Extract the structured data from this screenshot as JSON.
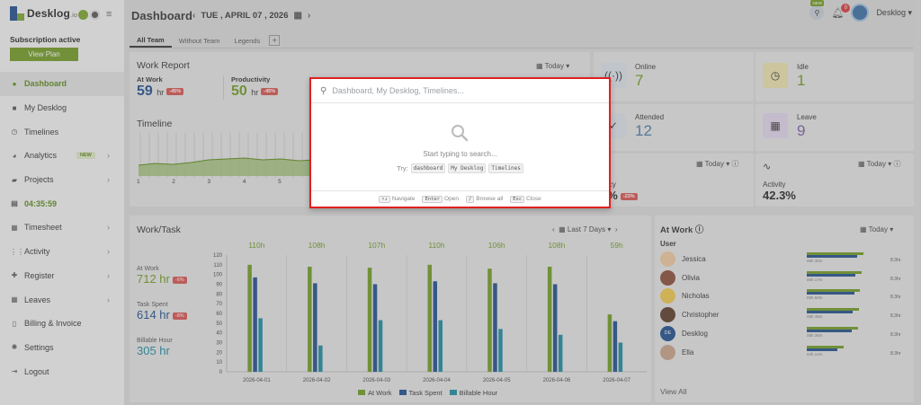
{
  "brand": {
    "name": "Desklog",
    "suffix": ".io"
  },
  "sidebar": {
    "subscription": "Subscription active",
    "view_plan": "View Plan",
    "items": [
      {
        "label": "Dashboard",
        "icon": "palette-icon"
      },
      {
        "label": "My Desklog",
        "icon": "briefcase-icon"
      },
      {
        "label": "Timelines",
        "icon": "clock-icon"
      },
      {
        "label": "Analytics",
        "icon": "pie-chart-icon",
        "badge": "NEW",
        "chevron": true
      },
      {
        "label": "Projects",
        "icon": "folder-icon",
        "chevron": true
      },
      {
        "label": "04:35:59",
        "icon": "timer-icon"
      },
      {
        "label": "Timesheet",
        "icon": "calendar-icon",
        "chevron": true
      },
      {
        "label": "Activity",
        "icon": "grid-icon",
        "chevron": true
      },
      {
        "label": "Register",
        "icon": "plus-icon",
        "chevron": true
      },
      {
        "label": "Leaves",
        "icon": "leaves-icon",
        "chevron": true
      },
      {
        "label": "Billing & Invoice",
        "icon": "invoice-icon"
      },
      {
        "label": "Settings",
        "icon": "gear-icon"
      },
      {
        "label": "Logout",
        "icon": "logout-icon"
      }
    ]
  },
  "header": {
    "title": "Dashboard",
    "date": "TUE , APRIL 07 , 2026",
    "notification_count": "0",
    "new_badge": "NEW",
    "user": "Desklog"
  },
  "tabs": [
    "All Team",
    "Without Team",
    "Legends"
  ],
  "work_report": {
    "title": "Work Report",
    "range": "Today",
    "at_work": {
      "label": "At Work",
      "value": "59",
      "unit": "hr",
      "delta": "-45%"
    },
    "productivity": {
      "label": "Productivity",
      "value": "50",
      "unit": "hr",
      "delta": "-45%"
    },
    "timeline_title": "Timeline",
    "timeline_ticks": [
      "1",
      "2",
      "3",
      "4",
      "5",
      "6"
    ]
  },
  "stats": {
    "online": {
      "label": "Online",
      "value": "7"
    },
    "idle": {
      "label": "Idle",
      "value": "1"
    },
    "attended": {
      "label": "Attended",
      "value": "12"
    },
    "leave": {
      "label": "Leave",
      "value": "9"
    },
    "efficiency": {
      "label": "ency",
      "value": "5%",
      "delta": "-23%",
      "range": "Today"
    },
    "activity": {
      "label": "Activity",
      "value": "42.3%",
      "range": "Today"
    }
  },
  "search_modal": {
    "placeholder": "Dashboard, My Desklog, Timelines...",
    "empty_text": "Start typing to search...",
    "try_label": "Try:",
    "suggestions": [
      "dashboard",
      "My Desklog",
      "Timelines"
    ],
    "footer": [
      {
        "key": "↑↓",
        "label": "Navigate"
      },
      {
        "key": "Enter",
        "label": "Open"
      },
      {
        "key": "/",
        "label": "Browse all"
      },
      {
        "key": "Esc",
        "label": "Close"
      }
    ]
  },
  "work_task": {
    "title": "Work/Task",
    "range": "Last 7 Days",
    "at_work": {
      "label": "At Work",
      "value": "712 hr",
      "delta": "-6%"
    },
    "task_spent": {
      "label": "Task Spent",
      "value": "614 hr",
      "delta": "-8%"
    },
    "billable": {
      "label": "Billable Hour",
      "value": "305 hr"
    }
  },
  "at_work_panel": {
    "title": "At Work",
    "range": "Today",
    "column": "User",
    "view_all": "View All",
    "users": [
      {
        "name": "Jessica",
        "time": "06h 30m",
        "total": "8.3hr",
        "color": "#f0c9a0",
        "work": 0.95,
        "task": 0.85
      },
      {
        "name": "Olivia",
        "time": "06h 17m",
        "total": "8.3hr",
        "color": "#8a4b38",
        "work": 0.93,
        "task": 0.82
      },
      {
        "name": "Nicholas",
        "time": "05h 50m",
        "total": "8.3hr",
        "color": "#f2c84b",
        "work": 0.9,
        "task": 0.8
      },
      {
        "name": "Christopher",
        "time": "05h 48m",
        "total": "8.3hr",
        "color": "#5b3a2a",
        "work": 0.88,
        "task": 0.78
      },
      {
        "name": "Desklog",
        "time": "05h 36m",
        "total": "8.3hr",
        "color": "#1d4d8c",
        "initials": "DE",
        "work": 0.86,
        "task": 0.75
      },
      {
        "name": "Ella",
        "time": "04h 14m",
        "total": "8.3hr",
        "color": "#c9a38a",
        "work": 0.62,
        "task": 0.52
      }
    ]
  },
  "chart_data": {
    "type": "bar",
    "categories": [
      "2026-04-01",
      "2026-04-02",
      "2026-04-03",
      "2026-04-04",
      "2026-04-05",
      "2026-04-06",
      "2026-04-07"
    ],
    "totals": [
      "110h",
      "108h",
      "107h",
      "110h",
      "106h",
      "108h",
      "59h"
    ],
    "series": [
      {
        "name": "At Work",
        "color": "#6f9a20",
        "values": [
          110,
          108,
          107,
          110,
          106,
          108,
          59
        ]
      },
      {
        "name": "Task Spent",
        "color": "#1d4d8c",
        "values": [
          97,
          91,
          90,
          93,
          91,
          90,
          52
        ]
      },
      {
        "name": "Billable Hour",
        "color": "#1b8aa0",
        "values": [
          55,
          27,
          53,
          53,
          44,
          38,
          30
        ]
      }
    ],
    "yticks": [
      0,
      10,
      20,
      30,
      40,
      50,
      60,
      70,
      80,
      90,
      100,
      110,
      120
    ],
    "ylim": [
      0,
      120
    ],
    "grid": false,
    "legend": "bottom"
  }
}
